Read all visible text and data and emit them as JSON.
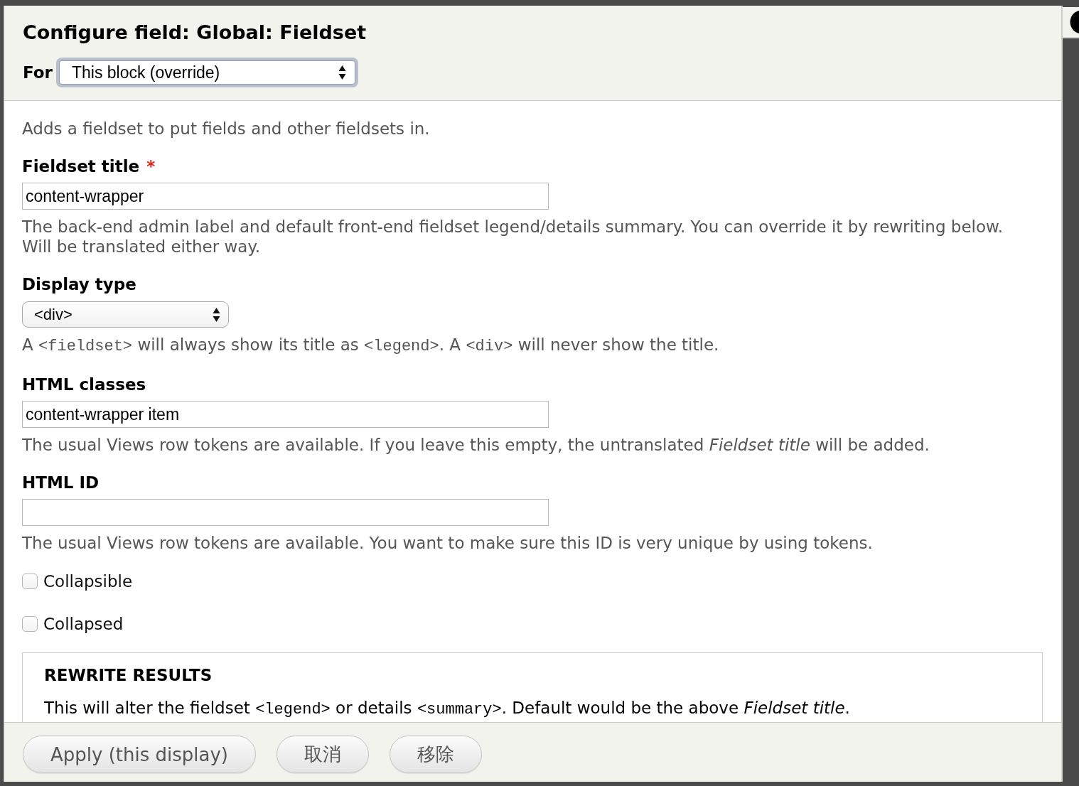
{
  "dialog": {
    "title": "Configure field: Global: Fieldset",
    "for_select": {
      "label": "For",
      "value": "This block (override)"
    },
    "description": "Adds a fieldset to put fields and other fieldsets in.",
    "fields": [
      {
        "kind": "text",
        "label": "Fieldset title",
        "required_mark": "*",
        "value": "content-wrapper",
        "help": [
          {
            "kind": "text",
            "text": "The back-end admin label and default front-end fieldset legend/details summary. You can override it by rewriting below. Will be translated either way."
          }
        ]
      },
      {
        "kind": "select",
        "label": "Display type",
        "value": "<div>",
        "help": [
          {
            "kind": "text",
            "text": "A "
          },
          {
            "kind": "code",
            "text": "<fieldset>"
          },
          {
            "kind": "text",
            "text": " will always show its title as "
          },
          {
            "kind": "code",
            "text": "<legend>"
          },
          {
            "kind": "text",
            "text": ". A "
          },
          {
            "kind": "code",
            "text": "<div>"
          },
          {
            "kind": "text",
            "text": " will never show the title."
          }
        ]
      },
      {
        "kind": "text",
        "label": "HTML classes",
        "value": "content-wrapper item",
        "help": [
          {
            "kind": "text",
            "text": "The usual Views row tokens are available. If you leave this empty, the untranslated *Fieldset title* will be added."
          }
        ]
      },
      {
        "kind": "text",
        "label": "HTML ID",
        "help": [
          {
            "kind": "text",
            "text": "The usual Views row tokens are available. You want to make sure this ID is very unique by using tokens."
          }
        ]
      }
    ],
    "checkboxes": [
      {
        "label": "Collapsible",
        "checked": false
      },
      {
        "label": "Collapsed",
        "checked": false
      }
    ],
    "rewrite_section": {
      "legend": "REWRITE RESULTS",
      "help": [
        {
          "kind": "text",
          "text": "This will alter the fieldset "
        },
        {
          "kind": "code",
          "text": "<legend>"
        },
        {
          "kind": "text",
          "text": " or details "
        },
        {
          "kind": "code",
          "text": "<summary>"
        },
        {
          "kind": "text",
          "text": ". Default would be the above *Fieldset title*."
        }
      ]
    },
    "buttons": [
      {
        "label": "Apply (this display)"
      },
      {
        "label": "取消"
      },
      {
        "label": "移除"
      }
    ]
  }
}
